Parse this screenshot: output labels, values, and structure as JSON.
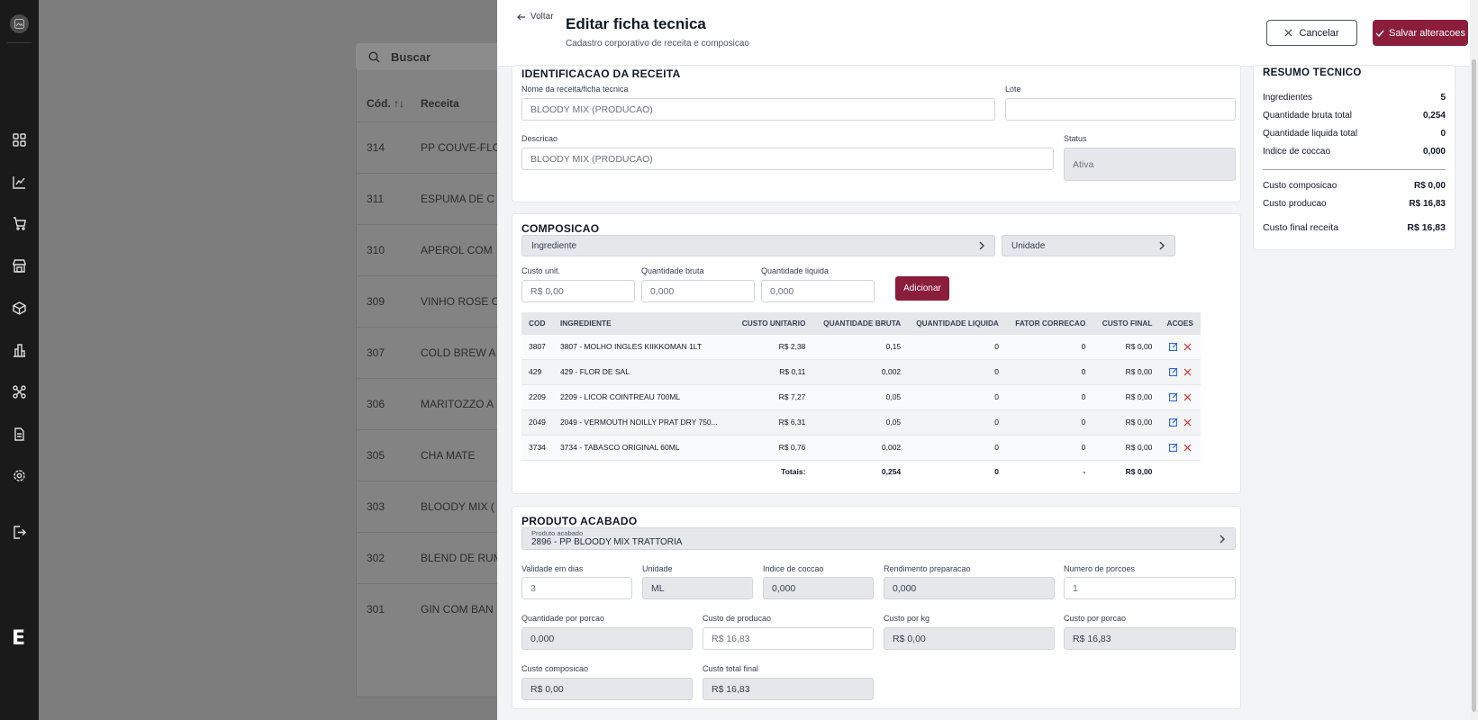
{
  "background": {
    "search_placeholder": "Buscar",
    "col_code": "Cód. ↑↓",
    "col_recipe": "Receita",
    "rows": [
      {
        "code": "314",
        "name": "PP COUVE-FLO"
      },
      {
        "code": "311",
        "name": "ESPUMA DE C"
      },
      {
        "code": "310",
        "name": "APEROL COM"
      },
      {
        "code": "309",
        "name": "VINHO ROSE C"
      },
      {
        "code": "307",
        "name": "COLD BREW A"
      },
      {
        "code": "306",
        "name": "MARITOZZO A"
      },
      {
        "code": "305",
        "name": "CHA MATE"
      },
      {
        "code": "303",
        "name": "BLOODY MIX ("
      },
      {
        "code": "302",
        "name": "BLEND DE RUM"
      },
      {
        "code": "301",
        "name": "GIN COM BAN"
      }
    ]
  },
  "rail": {
    "brand": "E"
  },
  "header": {
    "back_label": "Voltar",
    "title": "Editar ficha tecnica",
    "subtitle": "Cadastro corporativo de receita e composicao",
    "cancel_label": "Cancelar",
    "save_label": "Salvar alteracoes"
  },
  "identificacao": {
    "title": "IDENTIFICACAO DA RECEITA",
    "name_label": "Nome da receita/ficha tecnica",
    "name_value": "BLOODY MIX (PRODUCAO)",
    "lote_label": "Lote",
    "lote_value": "",
    "desc_label": "Descricao",
    "desc_value": "BLOODY MIX (PRODUCAO)",
    "status_label": "Status",
    "status_value": "Ativa"
  },
  "composicao": {
    "title": "COMPOSICAO",
    "ingrediente_placeholder": "Ingrediente",
    "unidade_placeholder": "Unidade",
    "custo_label": "Custo unit.",
    "custo_placeholder": "R$ 0,00",
    "qb_label": "Quantidade bruta",
    "qb_placeholder": "0,000",
    "ql_label": "Quantidade liquida",
    "ql_placeholder": "0,000",
    "add_label": "Adicionar",
    "columns": [
      "COD",
      "INGREDIENTE",
      "CUSTO UNITARIO",
      "QUANTIDADE BRUTA",
      "QUANTIDADE LIQUIDA",
      "FATOR CORRECAO",
      "CUSTO FINAL",
      "ACOES"
    ],
    "rows": [
      {
        "cod": "3807",
        "ingrediente": "3807 - MOLHO INGLES KIIKKOMAN 1LT",
        "custo": "R$ 2,38",
        "qb": "0,15",
        "ql": "0",
        "fator": "0",
        "final": "R$ 0,00"
      },
      {
        "cod": "429",
        "ingrediente": "429 - FLOR DE SAL",
        "custo": "R$ 0,11",
        "qb": "0,002",
        "ql": "0",
        "fator": "0",
        "final": "R$ 0,00"
      },
      {
        "cod": "2209",
        "ingrediente": "2209 - LICOR COINTREAU 700ML",
        "custo": "R$ 7,27",
        "qb": "0,05",
        "ql": "0",
        "fator": "0",
        "final": "R$ 0,00"
      },
      {
        "cod": "2049",
        "ingrediente": "2049 - VERMOUTH NOILLY PRAT DRY 750...",
        "custo": "R$ 6,31",
        "qb": "0,05",
        "ql": "0",
        "fator": "0",
        "final": "R$ 0,00"
      },
      {
        "cod": "3734",
        "ingrediente": "3734 - TABASCO ORIGINAL 60ML",
        "custo": "R$ 0,76",
        "qb": "0,002",
        "ql": "0",
        "fator": "0",
        "final": "R$ 0,00"
      }
    ],
    "totals": {
      "label": "Totais:",
      "qb": "0,254",
      "ql": "0",
      "fator": "-",
      "final": "R$ 0,00"
    }
  },
  "produto": {
    "title": "PRODUTO ACABADO",
    "produto_label": "Produto acabado",
    "produto_value": "2896 - PP BLOODY MIX TRATTORIA",
    "validade_label": "Validade em dias",
    "validade_value": "3",
    "unidade_label": "Unidade",
    "unidade_value": "ML",
    "coccao_label": "Indice de coccao",
    "coccao_value": "0,000",
    "rendimento_label": "Rendimento preparacao",
    "rendimento_value": "0,000",
    "porcoes_label": "Numero de porcoes",
    "porcoes_value": "1",
    "qpp_label": "Quantidade por porcao",
    "qpp_value": "0,000",
    "cprod_label": "Custo de producao",
    "cprod_value": "R$ 16,83",
    "ckg_label": "Custo por kg",
    "ckg_value": "R$ 0,00",
    "cpp_label": "Custo por porcao",
    "cpp_value": "R$ 16,83",
    "ccomp_label": "Custo composicao",
    "ccomp_value": "R$ 0,00",
    "ctot_label": "Custo total final",
    "ctot_value": "R$ 16,83"
  },
  "resumo": {
    "title": "RESUMO TECNICO",
    "items": [
      {
        "label": "Ingredientes",
        "value": "5"
      },
      {
        "label": "Quantidade bruta total",
        "value": "0,254"
      },
      {
        "label": "Quantidade liquida total",
        "value": "0"
      },
      {
        "label": "Indice de coccao",
        "value": "0,000"
      },
      {
        "label": "Custo composicao",
        "value": "R$ 0,00"
      },
      {
        "label": "Custo producao",
        "value": "R$ 16,83"
      },
      {
        "label": "Custo final receita",
        "value": "R$ 16,83"
      }
    ]
  }
}
